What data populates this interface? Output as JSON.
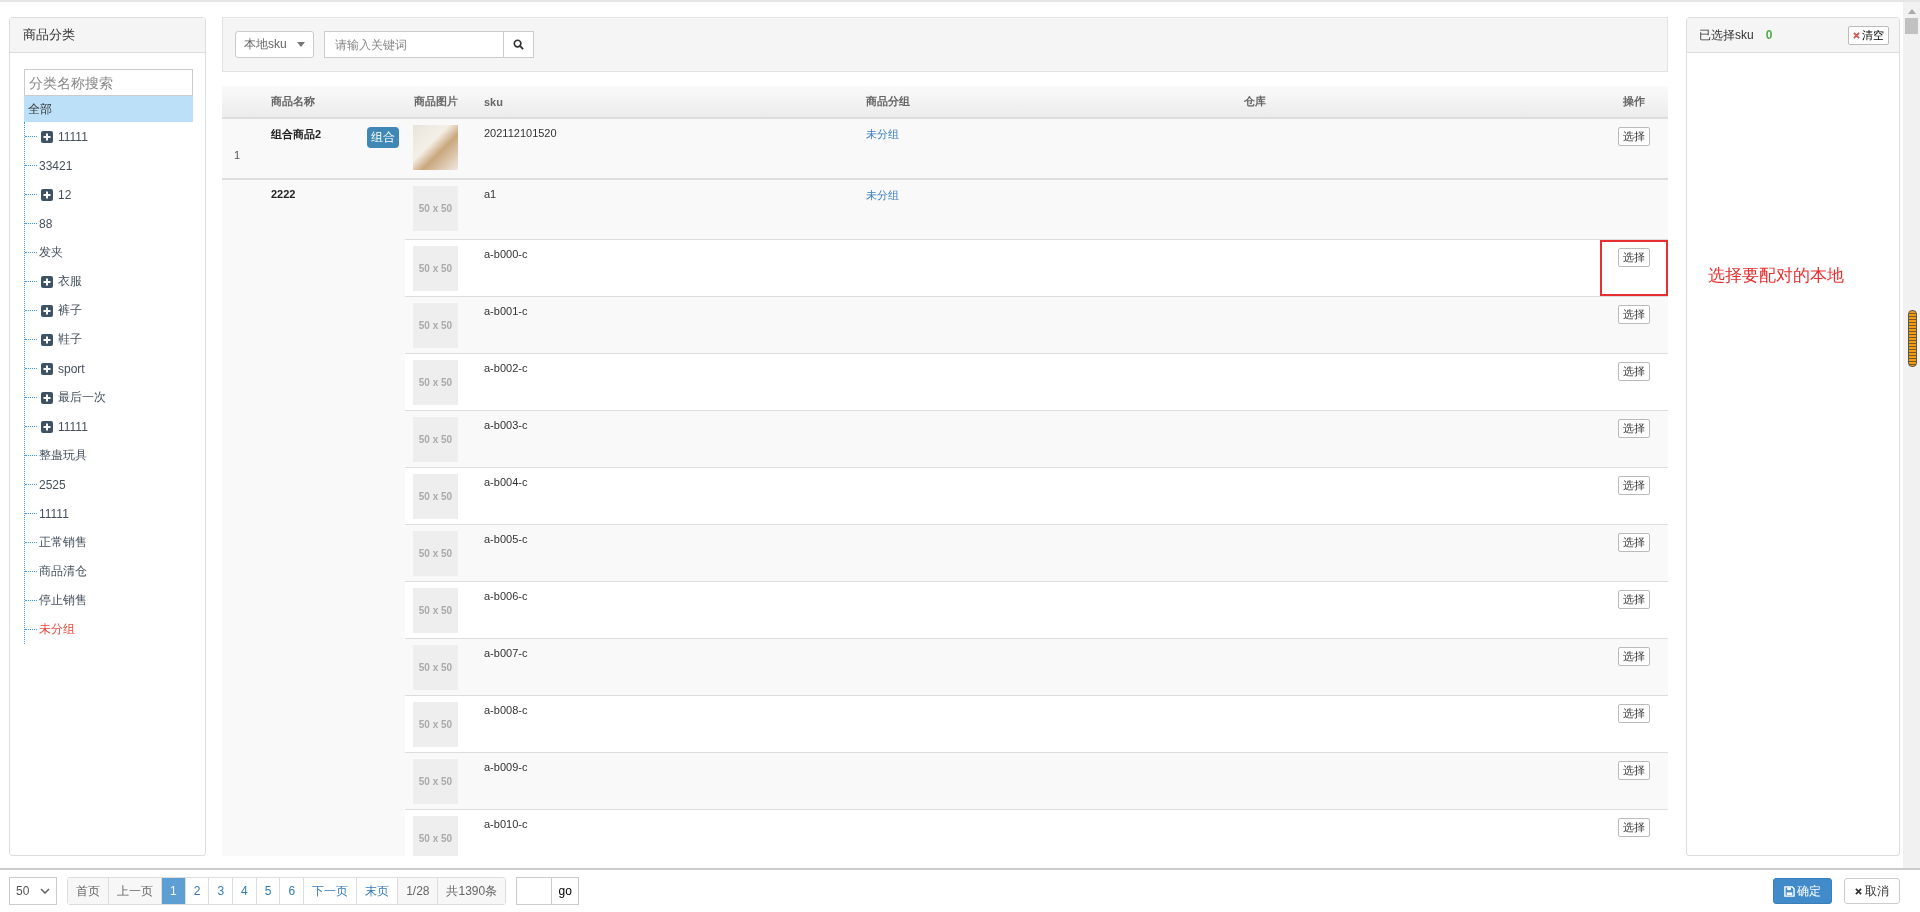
{
  "category_panel": {
    "title": "商品分类",
    "search": {
      "placeholder": "分类名称搜索"
    },
    "tree": {
      "label": "全部",
      "selected": true,
      "highlight": false,
      "children": [
        {
          "label": "11111",
          "expandable": true,
          "selected": false,
          "highlight": false
        },
        {
          "label": "33421",
          "expandable": false,
          "selected": false,
          "highlight": false
        },
        {
          "label": "12",
          "expandable": true,
          "selected": false,
          "highlight": false
        },
        {
          "label": "88",
          "expandable": false,
          "selected": false,
          "highlight": false
        },
        {
          "label": "发夹",
          "expandable": false,
          "selected": false,
          "highlight": false
        },
        {
          "label": "衣服",
          "expandable": true,
          "selected": false,
          "highlight": false
        },
        {
          "label": "裤子",
          "expandable": true,
          "selected": false,
          "highlight": false
        },
        {
          "label": "鞋子",
          "expandable": true,
          "selected": false,
          "highlight": false
        },
        {
          "label": "sport",
          "expandable": true,
          "selected": false,
          "highlight": false
        },
        {
          "label": "最后一次",
          "expandable": true,
          "selected": false,
          "highlight": false
        },
        {
          "label": "11111",
          "expandable": true,
          "selected": false,
          "highlight": false
        },
        {
          "label": "整蛊玩具",
          "expandable": false,
          "selected": false,
          "highlight": false
        },
        {
          "label": "2525",
          "expandable": false,
          "selected": false,
          "highlight": false
        },
        {
          "label": "11111",
          "expandable": false,
          "selected": false,
          "highlight": false
        },
        {
          "label": "正常销售",
          "expandable": false,
          "selected": false,
          "highlight": false
        },
        {
          "label": "商品清仓",
          "expandable": false,
          "selected": false,
          "highlight": false
        },
        {
          "label": "停止销售",
          "expandable": false,
          "selected": false,
          "highlight": false
        },
        {
          "label": "未分组",
          "expandable": false,
          "selected": false,
          "highlight": true
        }
      ]
    }
  },
  "toolbar": {
    "search_type": "本地sku",
    "keyword": {
      "placeholder": "请输入关键词"
    }
  },
  "table": {
    "columns": [
      "",
      "商品名称",
      "商品图片",
      "sku",
      "商品分组",
      "仓库",
      "操作"
    ],
    "products": [
      {
        "index": "1",
        "name": "组合商品2",
        "badge": "组合",
        "skus": [
          {
            "image": {
              "kind": "photo"
            },
            "sku": "202112101520",
            "group": "未分组",
            "action": "选择",
            "annotated": false
          }
        ]
      },
      {
        "name": "2222",
        "skus": [
          {
            "image": {
              "kind": "placeholder",
              "text": "50 x 50"
            },
            "sku": "a1",
            "group": "未分组",
            "annotated": false
          },
          {
            "image": {
              "kind": "placeholder",
              "text": "50 x 50"
            },
            "sku": "a-b000-c",
            "action": "选择",
            "annotated": true
          },
          {
            "image": {
              "kind": "placeholder",
              "text": "50 x 50"
            },
            "sku": "a-b001-c",
            "action": "选择",
            "annotated": false
          },
          {
            "image": {
              "kind": "placeholder",
              "text": "50 x 50"
            },
            "sku": "a-b002-c",
            "action": "选择",
            "annotated": false
          },
          {
            "image": {
              "kind": "placeholder",
              "text": "50 x 50"
            },
            "sku": "a-b003-c",
            "action": "选择",
            "annotated": false
          },
          {
            "image": {
              "kind": "placeholder",
              "text": "50 x 50"
            },
            "sku": "a-b004-c",
            "action": "选择",
            "annotated": false
          },
          {
            "image": {
              "kind": "placeholder",
              "text": "50 x 50"
            },
            "sku": "a-b005-c",
            "action": "选择",
            "annotated": false
          },
          {
            "image": {
              "kind": "placeholder",
              "text": "50 x 50"
            },
            "sku": "a-b006-c",
            "action": "选择",
            "annotated": false
          },
          {
            "image": {
              "kind": "placeholder",
              "text": "50 x 50"
            },
            "sku": "a-b007-c",
            "action": "选择",
            "annotated": false
          },
          {
            "image": {
              "kind": "placeholder",
              "text": "50 x 50"
            },
            "sku": "a-b008-c",
            "action": "选择",
            "annotated": false
          },
          {
            "image": {
              "kind": "placeholder",
              "text": "50 x 50"
            },
            "sku": "a-b009-c",
            "action": "选择",
            "annotated": false
          },
          {
            "image": {
              "kind": "placeholder",
              "text": "50 x 50"
            },
            "sku": "a-b010-c",
            "action": "选择",
            "annotated": false
          }
        ]
      }
    ]
  },
  "annotation": {
    "text": "选择要配对的本地"
  },
  "selected_panel": {
    "title": "已选择sku",
    "count": "0",
    "clear_button": "清空"
  },
  "footer": {
    "page_size": "50",
    "pagination": [
      {
        "kind": "nav",
        "label": "首页",
        "disabled": true
      },
      {
        "kind": "nav",
        "label": "上一页",
        "disabled": true
      },
      {
        "kind": "page",
        "label": "1",
        "selected": true
      },
      {
        "kind": "page",
        "label": "2",
        "selected": false
      },
      {
        "kind": "page",
        "label": "3",
        "selected": false
      },
      {
        "kind": "page",
        "label": "4",
        "selected": false
      },
      {
        "kind": "page",
        "label": "5",
        "selected": false
      },
      {
        "kind": "page",
        "label": "6",
        "selected": false
      },
      {
        "kind": "nav",
        "label": "下一页",
        "disabled": false
      },
      {
        "kind": "nav",
        "label": "末页",
        "disabled": false
      },
      {
        "kind": "info",
        "label": "1/28"
      },
      {
        "kind": "info",
        "label": "共1390条"
      }
    ],
    "go_button": "go",
    "confirm_button": "确定",
    "cancel_button": "取消"
  }
}
